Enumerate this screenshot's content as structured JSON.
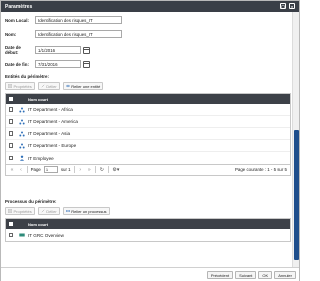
{
  "dialog": {
    "title": "Paramètres"
  },
  "form": {
    "local_name_label": "Nom Local:",
    "local_name_value": "Identification des risques_IT",
    "name_label": "Nom:",
    "name_value": "Identification des risques_IT",
    "start_date_label": "Date de début:",
    "start_date_value": "1/1/2016",
    "end_date_label": "Date de fin:",
    "end_date_value": "7/31/2016"
  },
  "entities_section": {
    "title": "Entités du périmètre:",
    "toolbar": {
      "properties": "Propriétés",
      "delete": "Délier",
      "link": "Relier une entité"
    },
    "grid": {
      "column": "Nom court",
      "rows": [
        {
          "name": "IT Department - Africa",
          "icon": "organization-icon"
        },
        {
          "name": "IT Department - America",
          "icon": "organization-icon"
        },
        {
          "name": "IT Department - Asia",
          "icon": "organization-icon"
        },
        {
          "name": "IT Department - Europe",
          "icon": "organization-icon"
        },
        {
          "name": "IT Employee",
          "icon": "person-icon"
        }
      ]
    },
    "pager": {
      "page_label": "Page",
      "page_value": "1",
      "of_label": "sur 1",
      "status": "Page courante : 1 - 5 sur 5"
    }
  },
  "processes_section": {
    "title": "Processus du périmètre:",
    "toolbar": {
      "properties": "Propriétés",
      "delete": "Délier",
      "link": "Relier un processus"
    },
    "grid": {
      "column": "Nom court",
      "rows": [
        {
          "name": "IT GRC Overview",
          "icon": "process-icon"
        }
      ]
    }
  },
  "footer": {
    "previous": "Précédent",
    "next": "Suivant",
    "ok": "OK",
    "cancel": "Annuler"
  },
  "colors": {
    "header": "#3a3f47",
    "accent": "#1e4e8c",
    "link_icon": "#2f6fb8"
  }
}
